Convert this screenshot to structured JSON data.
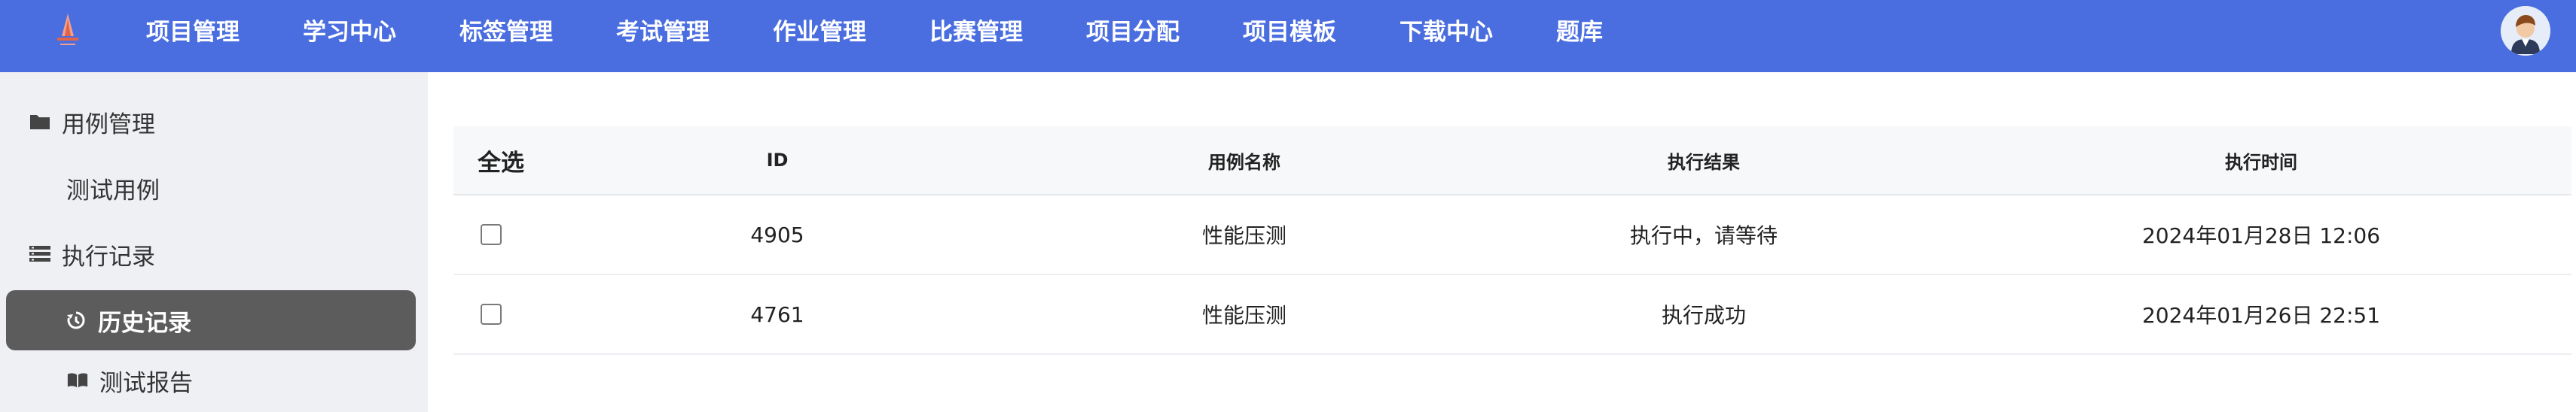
{
  "nav": {
    "items": [
      "项目管理",
      "学习中心",
      "标签管理",
      "考试管理",
      "作业管理",
      "比赛管理",
      "项目分配",
      "项目模板",
      "下载中心",
      "题库"
    ]
  },
  "sidebar": {
    "items": [
      {
        "label": "用例管理",
        "icon": "folder-icon"
      },
      {
        "label": "测试用例",
        "icon": ""
      },
      {
        "label": "执行记录",
        "icon": "list-icon"
      },
      {
        "label": "历史记录",
        "icon": "history-icon",
        "active": true
      },
      {
        "label": "测试报告",
        "icon": "book-icon"
      }
    ]
  },
  "table": {
    "select_all": "全选",
    "headers": [
      "ID",
      "用例名称",
      "执行结果",
      "执行时间"
    ],
    "rows": [
      {
        "id": "4905",
        "name": "性能压测",
        "result": "执行中，请等待",
        "time": "2024年01月28日 12:06"
      },
      {
        "id": "4761",
        "name": "性能压测",
        "result": "执行成功",
        "time": "2024年01月26日 22:51"
      }
    ]
  },
  "colors": {
    "topbar": "#4a6ee0",
    "sidebar_bg": "#eef0f4",
    "active_item": "#5c5c5c"
  }
}
